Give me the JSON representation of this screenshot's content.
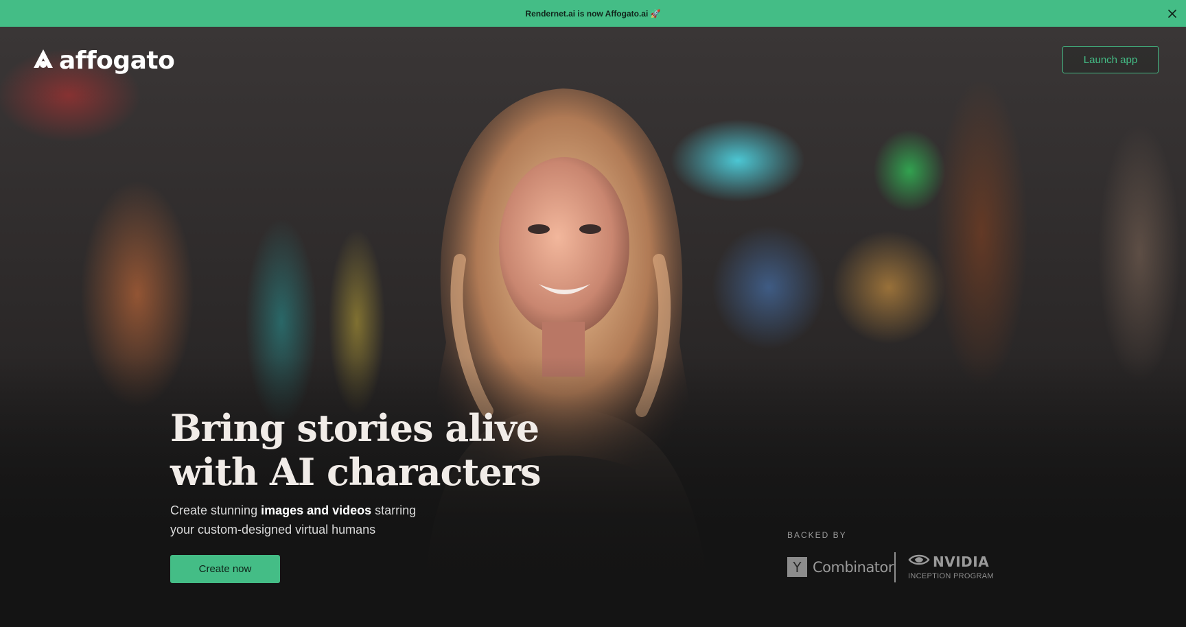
{
  "banner": {
    "message": "Rendernet.ai is now Affogato.ai 🚀",
    "background_color": "#44bd86",
    "close_icon": "close-icon"
  },
  "header": {
    "logo_text": "affogato",
    "logo_icon": "affogato-logo-icon",
    "launch_button_label": "Launch app"
  },
  "hero": {
    "headline_line1": "Bring stories alive",
    "headline_line2": "with AI characters",
    "subtitle_before": "Create stunning ",
    "subtitle_bold": "images and videos",
    "subtitle_after": " starring",
    "subtitle_line2": "your custom-designed virtual humans",
    "cta_label": "Create now",
    "accent_color": "#44bd86"
  },
  "backers": {
    "label": "BACKED BY",
    "yc_box_letter": "Y",
    "yc_name": "Combinator",
    "nvidia_name": "NVIDIA",
    "nvidia_program": "INCEPTION PROGRAM",
    "nvidia_icon": "nvidia-eye-icon"
  }
}
